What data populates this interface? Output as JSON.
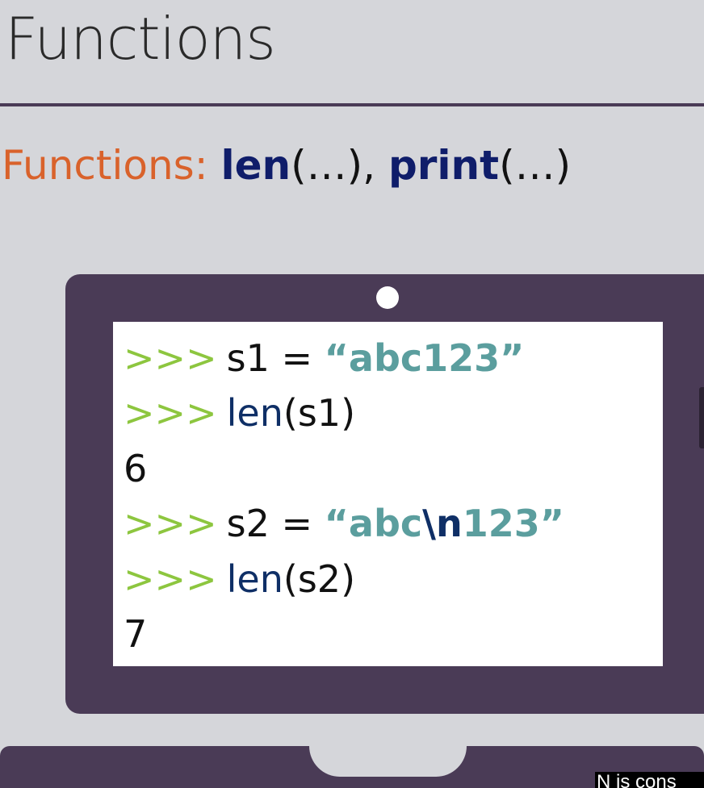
{
  "slide": {
    "title": "Functions"
  },
  "subtitle": {
    "label": "Functions:",
    "fn1": "len",
    "args1": "(…),",
    "fn2": "print",
    "args2": "(…)"
  },
  "terminal": {
    "prompt": ">>>",
    "lines": [
      {
        "var": "s1 = ",
        "str": "“abc123”"
      },
      {
        "func": "len",
        "args": "(s1)"
      },
      {
        "output": "6"
      },
      {
        "var": "s2 = ",
        "str_a": "“abc",
        "esc": "\\n",
        "str_b": "123”"
      },
      {
        "func": "len",
        "args": "(s2)"
      },
      {
        "output": "7"
      }
    ]
  },
  "caption": {
    "text": "N is cons"
  },
  "colors": {
    "background": "#d5d6da",
    "laptop": "#4a3b56",
    "label_orange": "#d9622b",
    "function_navy": "#0f1d6a",
    "prompt_green": "#8dc63f",
    "string_teal": "#5b9e9e"
  }
}
